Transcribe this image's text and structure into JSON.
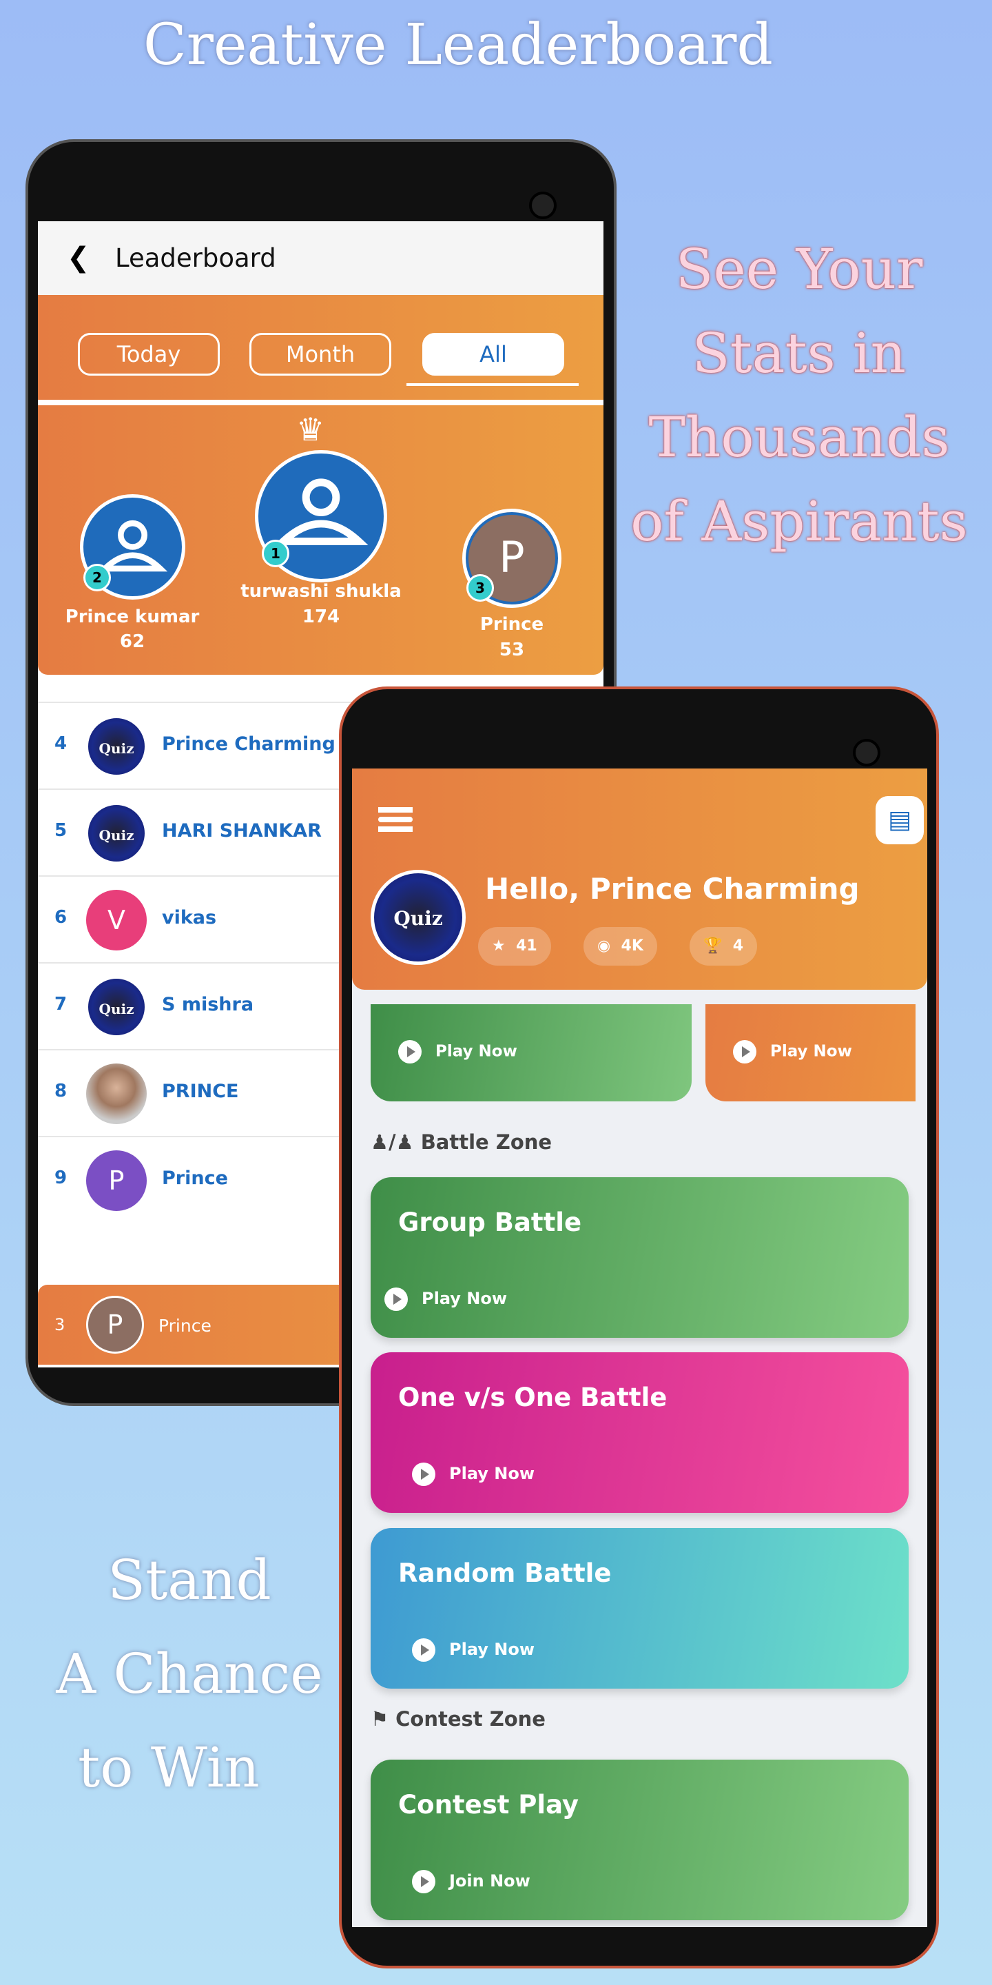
{
  "promo": {
    "title": "Creative Leaderboard",
    "right_lines": [
      "See Your",
      "Stats in",
      "Thousands",
      "of Aspirants"
    ],
    "left_lines": [
      "Stand",
      "A Chance",
      "to Win"
    ]
  },
  "leaderboard": {
    "title": "Leaderboard",
    "tabs": [
      {
        "label": "Today"
      },
      {
        "label": "Month"
      },
      {
        "label": "All",
        "active": true
      }
    ],
    "podium": [
      {
        "rank": "2",
        "name": "Prince kumar",
        "score": "62"
      },
      {
        "rank": "1",
        "name": "turwashi shukla",
        "score": "174"
      },
      {
        "rank": "3",
        "name": "Prince",
        "score": "53",
        "initial": "P"
      }
    ],
    "rows": [
      {
        "rank": "4",
        "name": "Prince Charming",
        "avatar": "Quiz"
      },
      {
        "rank": "5",
        "name": "HARI SHANKAR",
        "avatar": "Quiz"
      },
      {
        "rank": "6",
        "name": "vikas",
        "initial": "V",
        "color": "#e83e7a"
      },
      {
        "rank": "7",
        "name": "S mishra",
        "avatar": "Quiz"
      },
      {
        "rank": "8",
        "name": "PRINCE",
        "avatar": "photo"
      },
      {
        "rank": "9",
        "name": "Prince",
        "initial": "P",
        "color": "#7b4fc4"
      }
    ],
    "me": {
      "rank": "3",
      "name": "Prince",
      "initial": "P"
    }
  },
  "home": {
    "greeting": "Hello, Prince Charming",
    "avatar_text": "Quiz",
    "stats": [
      {
        "icon": "rank-shield-icon",
        "value": "41"
      },
      {
        "icon": "coin-bag-icon",
        "value": "4K"
      },
      {
        "icon": "trophy-icon",
        "value": "4"
      }
    ],
    "top_cards": [
      {
        "action": "Play Now"
      },
      {
        "action": "Play Now"
      }
    ],
    "battle_zone": "Battle Zone",
    "battles": [
      {
        "title": "Group Battle",
        "action": "Play Now"
      },
      {
        "title": "One v/s One Battle",
        "action": "Play Now"
      },
      {
        "title": "Random Battle",
        "action": "Play Now"
      }
    ],
    "contest_zone": "Contest Zone",
    "contest": {
      "title": "Contest Play",
      "action": "Join Now"
    }
  },
  "colors": {
    "orange_start": "#e57c42",
    "orange_end": "#ec9e42",
    "blue": "#1e6bbf",
    "green": "#4a9e55",
    "pink": "#e3308f",
    "teal": "#5cc8c8"
  }
}
